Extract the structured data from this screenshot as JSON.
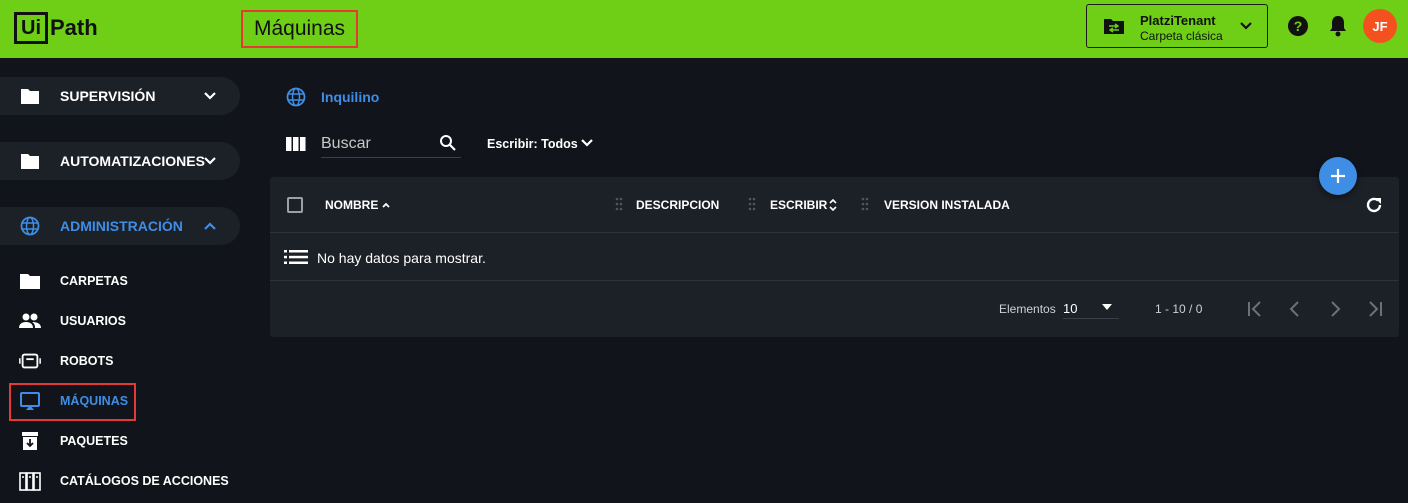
{
  "header": {
    "logo_box": "Ui",
    "logo_text": "Path",
    "page_title": "Máquinas",
    "tenant_name": "PlatziTenant",
    "tenant_folder": "Carpeta clásica",
    "avatar_initials": "JF",
    "background_color": "#6fcf17"
  },
  "sidebar": {
    "sections": [
      {
        "label": "SUPERVISIÓN",
        "icon": "folder-icon",
        "expanded": false
      },
      {
        "label": "AUTOMATIZACIONES",
        "icon": "folder-icon",
        "expanded": false
      },
      {
        "label": "ADMINISTRACIÓN",
        "icon": "globe-icon",
        "expanded": true
      }
    ],
    "items": [
      {
        "label": "CARPETAS",
        "icon": "folder-icon"
      },
      {
        "label": "USUARIOS",
        "icon": "users-icon"
      },
      {
        "label": "ROBOTS",
        "icon": "robot-icon"
      },
      {
        "label": "MÁQUINAS",
        "icon": "machine-icon",
        "active": true
      },
      {
        "label": "PAQUETES",
        "icon": "package-icon"
      },
      {
        "label": "CATÁLOGOS DE ACCIONES",
        "icon": "catalog-icon"
      }
    ]
  },
  "main": {
    "breadcrumb": "Inquilino",
    "search_placeholder": "Buscar",
    "filter_label": "Escribir: Todos",
    "table": {
      "columns": [
        "NOMBRE",
        "DESCRIPCION",
        "ESCRIBIR",
        "VERSION INSTALADA"
      ],
      "empty_message": "No hay datos para mostrar."
    },
    "pagination": {
      "label": "Elementos",
      "page_size": "10",
      "range": "1 - 10 / 0"
    }
  },
  "colors": {
    "accent": "#3f8ee6",
    "header": "#6fcf17",
    "avatar": "#f4511e",
    "highlight": "#e53935"
  }
}
